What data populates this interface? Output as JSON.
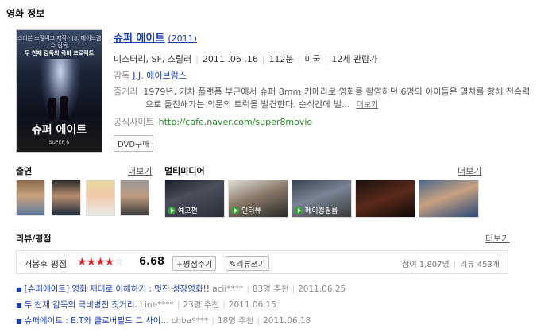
{
  "section_title": "영화 정보",
  "poster": {
    "top_text": "스티븐 스필버그 제작 · J.J. 에이브럼스 감독",
    "tagline": "두 천재 감독의 극비 프로젝트",
    "title": "슈퍼 에이트",
    "subtitle": "SUPER 8"
  },
  "movie": {
    "title": "슈퍼 에이트",
    "year": "(2011)",
    "genre": "미스터리, SF, 스릴러",
    "release": "2011 .06 .16",
    "runtime": "112분",
    "country": "미국",
    "rating": "12세 관람가",
    "director_label": "감독",
    "director": "J.J. 에이브럼스",
    "summary_label": "줄거리",
    "summary_line1": "1979년, 기차 플랫폼 부근에서 슈퍼 8mm 카메라로 영화를 촬영하던 6명의 아이들은 열차를 향해 전속력",
    "summary_line2": "으로 돌진해가는 의문의 트럭을 발견한다. 순식간에 벌...",
    "more": "더보기",
    "site_label": "공식사이트",
    "site_url": "http://cafe.naver.com/super8movie",
    "dvd_button": "DVD구매"
  },
  "cast": {
    "title": "출연",
    "more": "더보기"
  },
  "multimedia": {
    "title": "멀티미디어",
    "more": "더보기",
    "items": [
      {
        "label": "예고편",
        "icon": "play-icon"
      },
      {
        "label": "인터뷰",
        "icon": "play-icon"
      },
      {
        "label": "메이킹필름",
        "icon": "play-icon"
      }
    ]
  },
  "reviews": {
    "title": "리뷰/평점",
    "more": "더보기",
    "score_label": "개봉후 평점",
    "stars_filled": 3.5,
    "stars_total": 5,
    "score": "6.68",
    "rate_button": "+평점주기",
    "write_button": "리뷰쓰기",
    "participants": "참여 1,807명",
    "review_count": "리뷰 453개",
    "items": [
      {
        "title": "[슈퍼에이트] 영화 제대로 이해하기 : 멋진 성장영화!!",
        "author": "acii****",
        "recommend": "83명 추천",
        "date": "2011.06.25"
      },
      {
        "title": "두 천재 감독의 극비병진 짓거리.",
        "author": "cine****",
        "recommend": "23명 추천",
        "date": "2011.06.15"
      },
      {
        "title": "슈퍼에이트 : E.T와 클로버필드 그 사이...",
        "author": "chba****",
        "recommend": "18명 추천",
        "date": "2011.06.18"
      }
    ]
  },
  "colors": {
    "link": "#1a3fb0",
    "star": "#d8252b",
    "url": "#2a8a2a"
  }
}
